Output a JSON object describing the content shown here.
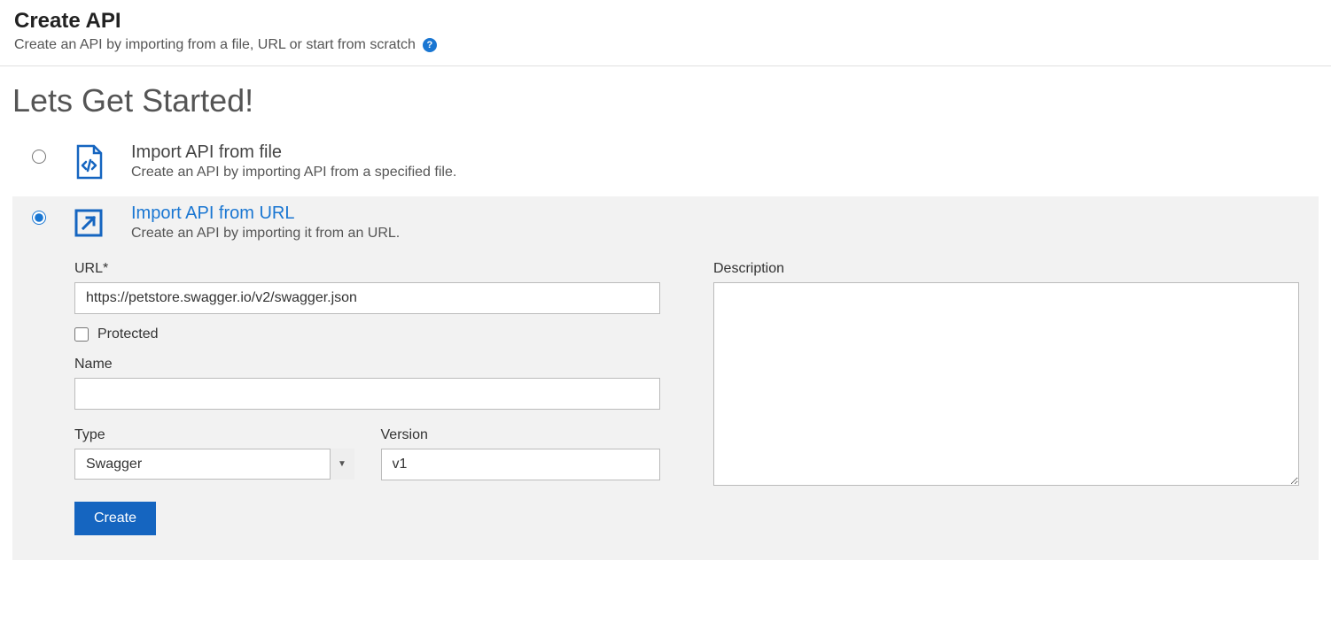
{
  "header": {
    "title": "Create API",
    "subtitle": "Create an API by importing from a file, URL or start from scratch"
  },
  "main": {
    "heading": "Lets Get Started!",
    "options": {
      "file": {
        "title": "Import API from file",
        "desc": "Create an API by importing API from a specified file."
      },
      "url": {
        "title": "Import API from URL",
        "desc": "Create an API by importing it from an URL."
      }
    },
    "form": {
      "url_label": "URL*",
      "url_value": "https://petstore.swagger.io/v2/swagger.json",
      "protected_label": "Protected",
      "name_label": "Name",
      "name_value": "",
      "type_label": "Type",
      "type_value": "Swagger",
      "version_label": "Version",
      "version_value": "v1",
      "description_label": "Description",
      "description_value": "",
      "create_button": "Create"
    }
  }
}
